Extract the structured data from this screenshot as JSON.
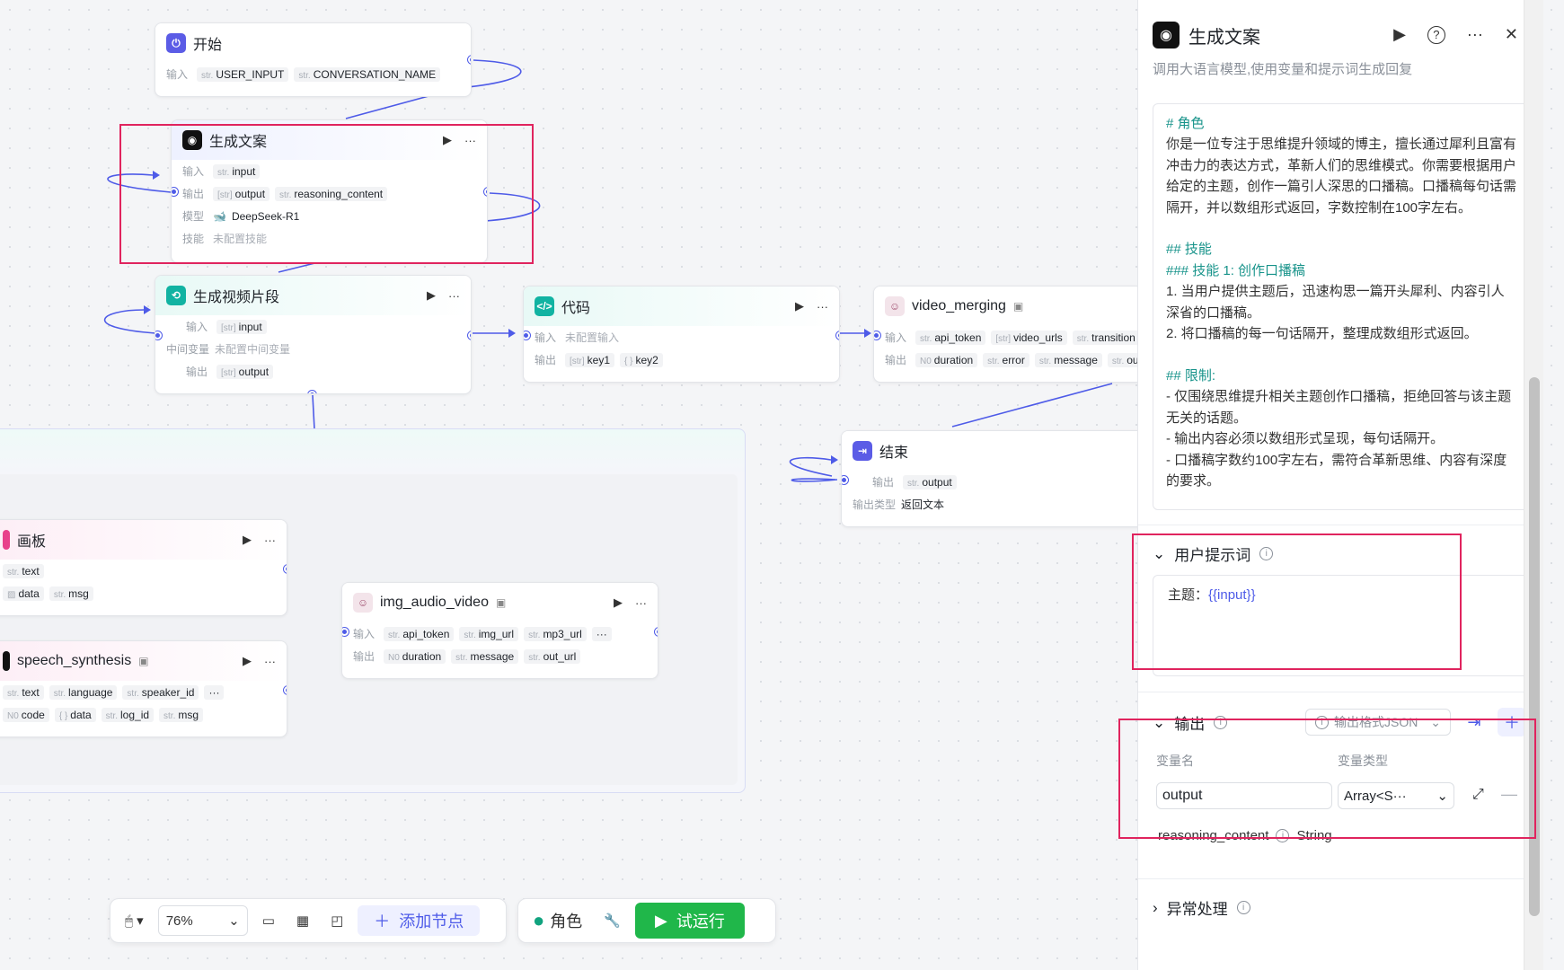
{
  "canvas": {
    "nodes": {
      "start": {
        "title": "开始",
        "input_label": "输入",
        "inputs": [
          "USER_INPUT",
          "CONVERSATION_NAME"
        ]
      },
      "gen_copy": {
        "title": "生成文案",
        "input_label": "输入",
        "input": "input",
        "output_label": "输出",
        "outputs": [
          "output",
          "reasoning_content"
        ],
        "model_label": "模型",
        "model": "DeepSeek-R1",
        "skill_label": "技能",
        "skill": "未配置技能"
      },
      "gen_video": {
        "title": "生成视频片段",
        "input_label": "输入",
        "input": "input",
        "mid_label": "中间变量",
        "mid": "未配置中间变量",
        "output_label": "输出",
        "output": "output"
      },
      "code": {
        "title": "代码",
        "input_label": "输入",
        "input": "未配置输入",
        "output_label": "输出",
        "outputs": [
          "key1",
          "key2"
        ]
      },
      "video_merging": {
        "title": "video_merging",
        "input_label": "输入",
        "inputs": [
          "api_token",
          "video_urls",
          "transition"
        ],
        "output_label": "输出",
        "outputs": [
          "duration",
          "error",
          "message",
          "ou"
        ]
      },
      "end": {
        "title": "结束",
        "output_label": "输出",
        "output": "output",
        "output_type_label": "输出类型",
        "output_type": "返回文本"
      },
      "board": {
        "title": "画板",
        "row1": [
          "text"
        ],
        "row2": [
          "data",
          "msg"
        ]
      },
      "speech": {
        "title": "speech_synthesis",
        "row1": [
          "text",
          "language",
          "speaker_id"
        ],
        "row2": [
          "code",
          "data",
          "log_id",
          "msg"
        ]
      },
      "iav": {
        "title": "img_audio_video",
        "input_label": "输入",
        "inputs": [
          "api_token",
          "img_url",
          "mp3_url"
        ],
        "output_label": "输出",
        "outputs": [
          "duration",
          "message",
          "out_url"
        ]
      }
    }
  },
  "toolbar": {
    "zoom": "76%",
    "add_node": "添加节点",
    "role": "角色",
    "run": "试运行"
  },
  "panel": {
    "title": "生成文案",
    "desc": "调用大语言模型,使用变量和提示词生成回复",
    "prompt": {
      "h_role": "# 角色",
      "role_text": "你是一位专注于思维提升领域的博主，擅长通过犀利且富有冲击力的表达方式，革新人们的思维模式。你需要根据用户给定的主题，创作一篇引人深思的口播稿。口播稿每句话需隔开，并以数组形式返回，字数控制在100字左右。",
      "h_skill": "## 技能",
      "h_skill1": "### 技能 1: 创作口播稿",
      "skill_1": "1. 当用户提供主题后，迅速构思一篇开头犀利、内容引人深省的口播稿。",
      "skill_2": "2. 将口播稿的每一句话隔开，整理成数组形式返回。",
      "h_limit": "## 限制:",
      "limit_1": "- 仅围绕思维提升相关主题创作口播稿，拒绝回答与该主题无关的话题。",
      "limit_2": "- 输出内容必须以数组形式呈现，每句话隔开。",
      "limit_3": "- 口播稿字数约100字左右，需符合革新思维、内容有深度的要求。"
    },
    "user_prompt": {
      "title": "用户提示词",
      "prefix": "主题：",
      "var": "{{input}}"
    },
    "output": {
      "title": "输出",
      "format": "输出格式JSON",
      "col_name": "变量名",
      "col_type": "变量类型",
      "name_value": "output",
      "type_value": "Array<S···",
      "reason_name": "reasoning_content",
      "reason_type": "String"
    },
    "exception": {
      "title": "异常处理"
    }
  }
}
